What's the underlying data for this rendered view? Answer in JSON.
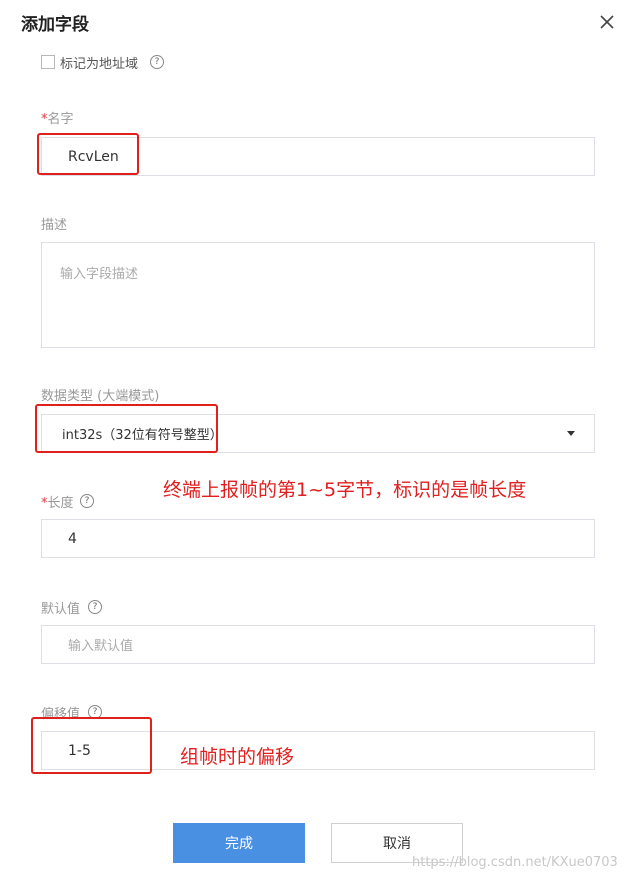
{
  "dialog": {
    "title": "添加字段",
    "close_icon": "close-icon"
  },
  "address_field": {
    "label": "标记为地址域",
    "checked": false,
    "help_icon": "question-circle-icon"
  },
  "name": {
    "required_mark": "*",
    "label": "名字",
    "value": "RcvLen"
  },
  "description": {
    "label": "描述",
    "placeholder": "输入字段描述"
  },
  "data_type": {
    "label": "数据类型 (大端模式)",
    "value": "int32s（32位有符号整型）",
    "dropdown_icon": "caret-down-icon"
  },
  "length": {
    "required_mark": "*",
    "label": "长度",
    "value": "4",
    "help_icon": "question-circle-icon"
  },
  "default_value": {
    "label": "默认值",
    "placeholder": "输入默认值",
    "help_icon": "question-circle-icon"
  },
  "offset": {
    "label": "偏移值",
    "value": "1-5",
    "help_icon": "question-circle-icon"
  },
  "annotations": {
    "length_note": "终端上报帧的第1~5字节，标识的是帧长度",
    "offset_note": "组帧时的偏移",
    "color": "#e02020"
  },
  "buttons": {
    "confirm": "完成",
    "cancel": "取消"
  },
  "watermark": "https://blog.csdn.net/KXue0703",
  "colors": {
    "primary": "#4a90e2",
    "border": "#dcdfe6",
    "required": "#e4393c"
  }
}
